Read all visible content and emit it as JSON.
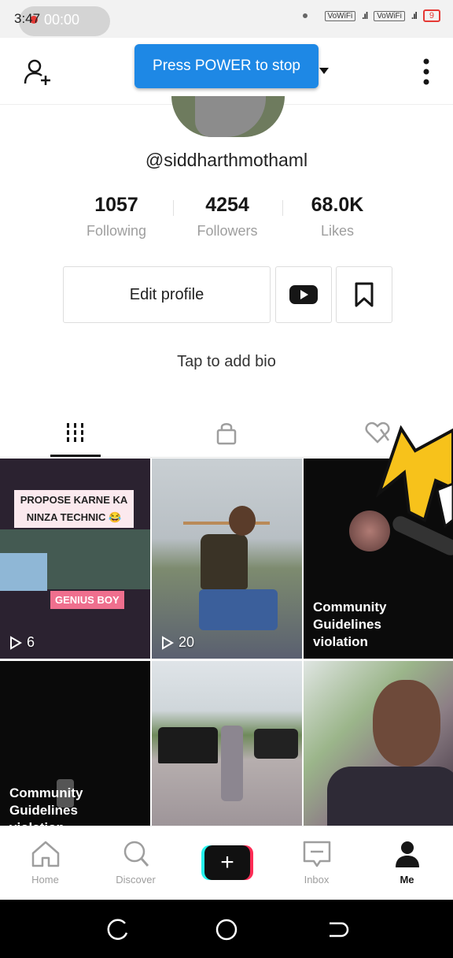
{
  "status_bar": {
    "time": "3:47",
    "recording_timer": "00:00",
    "network1": "VoWiFi",
    "network2": "VoWiFi",
    "battery": "9"
  },
  "header": {
    "username_title": "siddharthmothaml",
    "toast": "Press POWER to stop"
  },
  "profile": {
    "handle": "@siddharthmothaml",
    "stats": [
      {
        "value": "1057",
        "label": "Following"
      },
      {
        "value": "4254",
        "label": "Followers"
      },
      {
        "value": "68.0K",
        "label": "Likes"
      }
    ],
    "edit_button": "Edit profile",
    "bio_prompt": "Tap to add bio"
  },
  "videos": [
    {
      "caption": "PROPOSE KARNE KA NINZA TECHNIC 😂",
      "tag": "GENIUS BOY",
      "views": "6"
    },
    {
      "views": "20"
    },
    {
      "notice": "Community Guidelines violation"
    },
    {
      "notice": "Community Guidelines violation"
    },
    {},
    {}
  ],
  "bottom_nav": [
    {
      "label": "Home",
      "icon": "home-icon"
    },
    {
      "label": "Discover",
      "icon": "search-icon"
    },
    {
      "label": "",
      "icon": "plus-icon"
    },
    {
      "label": "Inbox",
      "icon": "inbox-icon"
    },
    {
      "label": "Me",
      "icon": "person-icon"
    }
  ],
  "colors": {
    "accent_blue": "#1e88e5",
    "tiktok_red": "#fe2c55",
    "tiktok_cyan": "#25f4ee"
  }
}
